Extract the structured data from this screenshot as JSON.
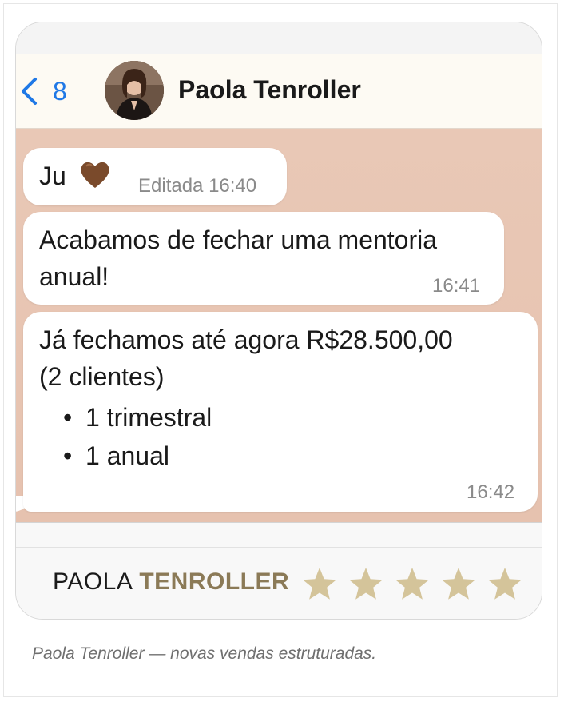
{
  "chat_header": {
    "back_count": "8",
    "contact_name": "Paola Tenroller"
  },
  "messages": [
    {
      "text": "Ju",
      "emoji": "brown-heart-icon",
      "meta": "Editada 16:40"
    },
    {
      "line1": "Acabamos de fechar uma mentoria",
      "line2": "anual!",
      "time": "16:41"
    },
    {
      "line1": "Já fechamos até agora R$28.500,00",
      "line2": "(2 clientes)",
      "bullets": [
        "1 trimestral",
        "1 anual"
      ],
      "time": "16:42"
    }
  ],
  "footer": {
    "brand_first": "PAOLA",
    "brand_second": "TENROLLER",
    "rating": 5,
    "star_color": "#d4c49a"
  },
  "caption": "Paola Tenroller — novas vendas estruturadas.",
  "colors": {
    "ios_blue": "#1f78e6",
    "chat_background": "#e8c6b4",
    "brand_accent": "#8b7a57"
  }
}
